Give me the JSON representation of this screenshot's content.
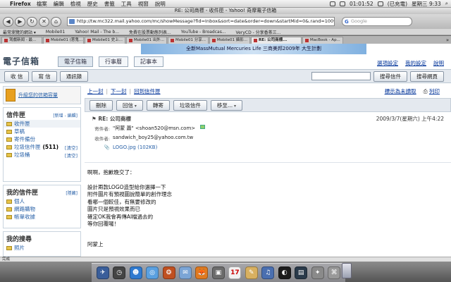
{
  "menubar": {
    "apple": "",
    "app": "Firefox",
    "items": [
      "檔案",
      "編輯",
      "檢視",
      "歷史",
      "書籤",
      "工具",
      "視窗",
      "說明"
    ],
    "status": {
      "time_left": "01:01:52",
      "battery": "(已充電)",
      "clock": "星期三 9:33"
    }
  },
  "window": {
    "title": "RE: 公司商標 - 收件匣 - Yahoo! 奇摩電子信箱"
  },
  "toolbar": {
    "back": "◀",
    "forward": "▶",
    "reload": "↻",
    "stop": "✕",
    "home": "⌂",
    "url": "http://tw.mc322.mail.yahoo.com/mc/showMessage?fid=Inbox&sort=date&order=down&startMid=0&.rand=1009022",
    "search_placeholder": "Google"
  },
  "bookmarks": [
    "最常瀏覽的網站 ▾",
    "Mobile01",
    "Yahoo! Mail - The b...",
    "免費在股票動態列表...",
    "YouTube - Broadcas...",
    "VeryCD - 分享香茶三..."
  ],
  "tabs": [
    {
      "label": "驾戲新闻 - 最...",
      "active": false
    },
    {
      "label": "Mobile01 (蔥鬼...",
      "active": false
    },
    {
      "label": "Mobile01 史上...",
      "active": false
    },
    {
      "label": "Mobile01 出外...",
      "active": false
    },
    {
      "label": "Mobile01 分享...",
      "active": false
    },
    {
      "label": "Mobile01 攝影...",
      "active": false
    },
    {
      "label": "RE: 公司商標...",
      "active": true
    },
    {
      "label": "MacBook - Ap...",
      "active": false
    }
  ],
  "yahoo": {
    "logo": "電子信箱",
    "tabs": [
      "電子信箱",
      "行事曆",
      "記事本"
    ],
    "banner": "全新MassMutual Mercuries Life 三商美邦2009年 大生計劃",
    "links": [
      "選項設定",
      "我的設定",
      "說明"
    ]
  },
  "actions": {
    "receive": "收 信",
    "compose": "寫 信",
    "contacts": "通訊錄",
    "search_mail": "搜尋信件",
    "search_web": "搜尋網頁"
  },
  "sidebar": {
    "top_link": "升級您的信箱容量",
    "folders_title": "信件匣",
    "folders_actions": "[新增 - 編輯]",
    "folders": [
      {
        "name": "收件匣",
        "count": "",
        "clear": ""
      },
      {
        "name": "草稿",
        "count": "",
        "clear": ""
      },
      {
        "name": "寄件備份",
        "count": "",
        "clear": ""
      },
      {
        "name": "垃圾信件匣",
        "count": "(511)",
        "clear": "[清空]"
      },
      {
        "name": "垃圾桶",
        "count": "",
        "clear": "[清空]"
      }
    ],
    "mine_title": "我的信件匣",
    "mine_action": "[隱藏]",
    "mine": [
      "個人",
      "網路購物",
      "帳單收據"
    ],
    "search_title": "我的搜尋",
    "search": [
      "照片"
    ]
  },
  "message": {
    "prev": "上一封",
    "next": "下一封",
    "back": "回到信件匣",
    "show_full_headers": "標示為未讀取",
    "print": "列印",
    "buttons": {
      "delete": "刪除",
      "reply": "回信",
      "forward": "轉寄",
      "spam": "垃圾信件",
      "move": "移至..."
    },
    "subject": "RE: 公司商標",
    "date": "2009/3/7(星期六) 上午4:22",
    "from_label": "寄件者:",
    "from": "\"阿蒙 蕭\" <shoan520@msn.com>",
    "to_label": "收件者:",
    "to": "sandwich_boy25@yahoo.com.tw",
    "attachment": "LOGO.jpg (102KB)",
    "body": [
      "啊啊，抱歉晚交了：",
      "設計兩款LOGO造型給你選擇一下\n附件圖片有預視圖說簡單的創作理念\n看哪一個較佳，有無要修改的\n圖片只是預視效果而已\n確定OK我會再傳AI檔過去的\n等你回覆囉！",
      "阿蒙上"
    ]
  },
  "status": {
    "text": "完成"
  },
  "dock": {
    "items": [
      "✈",
      "◷",
      "☻",
      "◎",
      "❂",
      "✉",
      "🦊",
      "▣",
      "17",
      "✎",
      "♫",
      "◐",
      "▤",
      "✦",
      "⌘"
    ]
  }
}
